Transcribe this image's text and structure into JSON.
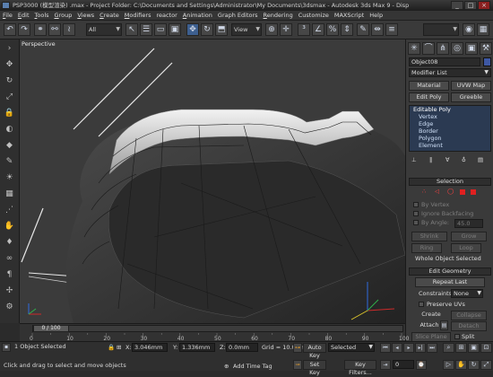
{
  "window": {
    "title": "PSP3000 (模型渲染) .max   - Project Folder: C:\\Documents and Settings\\Administrator\\My Documents\\3dsmax   - Autodesk 3ds Max 9   - Disp",
    "min": "_",
    "max": "□",
    "close": "×"
  },
  "menubar": {
    "items": [
      {
        "u": "F",
        "rest": "ile"
      },
      {
        "u": "E",
        "rest": "dit"
      },
      {
        "u": "T",
        "rest": "ools"
      },
      {
        "u": "G",
        "rest": "roup"
      },
      {
        "u": "V",
        "rest": "iews"
      },
      {
        "u": "C",
        "rest": "reate"
      },
      {
        "u": "M",
        "rest": "odifiers"
      },
      {
        "u": "",
        "rest": "reactor"
      },
      {
        "u": "A",
        "rest": "nimation"
      },
      {
        "u": "",
        "rest": "Graph Editors"
      },
      {
        "u": "R",
        "rest": "endering"
      },
      {
        "u": "",
        "rest": "Customize"
      },
      {
        "u": "",
        "rest": "MAXScript"
      },
      {
        "u": "",
        "rest": "Help"
      }
    ]
  },
  "toolbar": {
    "filter_select": "All",
    "coord_select": "View",
    "named_selection": ""
  },
  "viewport": {
    "label": "Perspective"
  },
  "panel": {
    "object_name": "Object08",
    "object_color": "#3e58a3",
    "modifier_list": "Modifier List",
    "btn_material": "Material",
    "btn_uvw": "UVW Map",
    "btn_editpoly": "Edit Poly",
    "btn_greeble": "Greeble",
    "stack": [
      "Editable Poly",
      "Vertex",
      "Edge",
      "Border",
      "Polygon",
      "Element"
    ],
    "selection_title": "Selection",
    "by_vertex": "By Vertex",
    "ignore_backfacing": "Ignore Backfacing",
    "by_angle": "By Angle:",
    "angle_value": "45.0",
    "btn_shrink": "Shrink",
    "btn_grow": "Grow",
    "btn_ring": "Ring",
    "btn_loop": "Loop",
    "whole_selected": "Whole Object Selected",
    "edit_geometry_title": "Edit Geometry",
    "btn_repeat_last": "Repeat Last",
    "constraints_label": "Constraints:",
    "constraints_value": "None",
    "preserve_uvs": "Preserve UVs",
    "btn_create": "Create",
    "btn_collapse": "Collapse",
    "btn_attach": "Attach",
    "btn_detach": "Detach",
    "btn_slice_plane": "Slice Plane",
    "split": "Split"
  },
  "timeline": {
    "frame_label": "0 / 100",
    "ticks": [
      "0",
      "10",
      "20",
      "30",
      "40",
      "50",
      "60",
      "70",
      "80",
      "90",
      "100"
    ]
  },
  "status": {
    "objects_selected": "1 Object Selected",
    "prompt": "Click and drag to select and move objects",
    "x_label": "X:",
    "x_value": "3.046mm",
    "y_label": "Y:",
    "y_value": "1.336mm",
    "z_label": "Z:",
    "z_value": "0.0mm",
    "grid": "Grid = 10.0mm",
    "add_time_tag": "Add Time Tag",
    "auto_key": "Auto Key",
    "selected_dropdown": "Selected",
    "set_key": "Set Key",
    "key_filters": "Key Filters...",
    "frame_value": "0"
  }
}
